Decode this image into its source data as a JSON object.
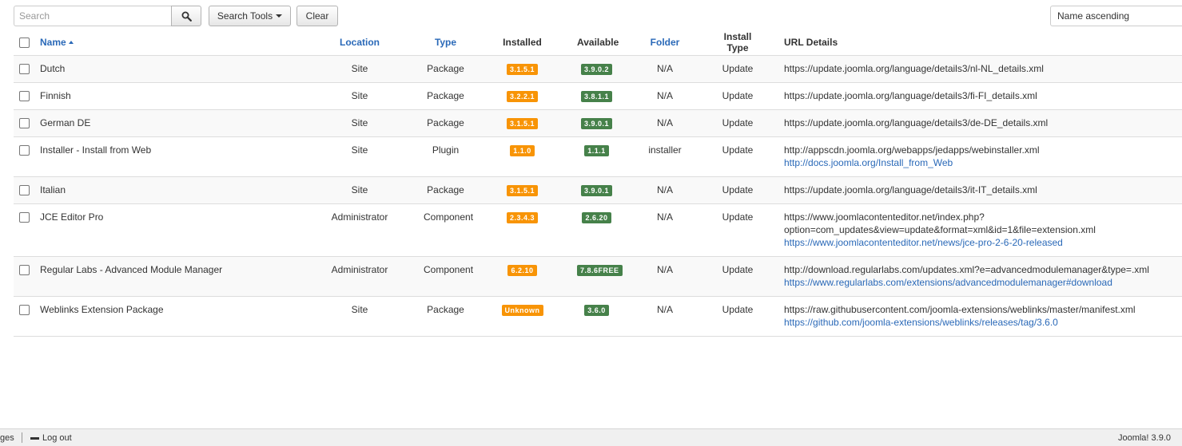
{
  "toolbar": {
    "search_placeholder": "Search",
    "search_icon": "magnifier-icon",
    "search_tools_label": "Search Tools",
    "clear_label": "Clear",
    "sort_value": "Name ascending"
  },
  "table": {
    "columns": {
      "name": "Name",
      "location": "Location",
      "type": "Type",
      "installed": "Installed",
      "available": "Available",
      "folder": "Folder",
      "install_type": "Install Type",
      "url_details": "URL Details"
    },
    "rows": [
      {
        "name": "Dutch",
        "location": "Site",
        "type": "Package",
        "installed": "3.1.5.1",
        "available": "3.9.0.2",
        "folder": "N/A",
        "install_type": "Update",
        "url": "https://update.joomla.org/language/details3/nl-NL_details.xml",
        "url2": "",
        "link": ""
      },
      {
        "name": "Finnish",
        "location": "Site",
        "type": "Package",
        "installed": "3.2.2.1",
        "available": "3.8.1.1",
        "folder": "N/A",
        "install_type": "Update",
        "url": "https://update.joomla.org/language/details3/fi-FI_details.xml",
        "url2": "",
        "link": ""
      },
      {
        "name": "German DE",
        "location": "Site",
        "type": "Package",
        "installed": "3.1.5.1",
        "available": "3.9.0.1",
        "folder": "N/A",
        "install_type": "Update",
        "url": "https://update.joomla.org/language/details3/de-DE_details.xml",
        "url2": "",
        "link": ""
      },
      {
        "name": "Installer - Install from Web",
        "location": "Site",
        "type": "Plugin",
        "installed": "1.1.0",
        "available": "1.1.1",
        "folder": "installer",
        "install_type": "Update",
        "url": "http://appscdn.joomla.org/webapps/jedapps/webinstaller.xml",
        "url2": "",
        "link": "http://docs.joomla.org/Install_from_Web"
      },
      {
        "name": "Italian",
        "location": "Site",
        "type": "Package",
        "installed": "3.1.5.1",
        "available": "3.9.0.1",
        "folder": "N/A",
        "install_type": "Update",
        "url": "https://update.joomla.org/language/details3/it-IT_details.xml",
        "url2": "",
        "link": ""
      },
      {
        "name": "JCE Editor Pro",
        "location": "Administrator",
        "type": "Component",
        "installed": "2.3.4.3",
        "available": "2.6.20",
        "folder": "N/A",
        "install_type": "Update",
        "url": "https://www.joomlacontenteditor.net/index.php?",
        "url2": "option=com_updates&view=update&format=xml&id=1&file=extension.xml",
        "link": "https://www.joomlacontenteditor.net/news/jce-pro-2-6-20-released"
      },
      {
        "name": "Regular Labs - Advanced Module Manager",
        "location": "Administrator",
        "type": "Component",
        "installed": "6.2.10",
        "available": "7.8.6FREE",
        "folder": "N/A",
        "install_type": "Update",
        "url": "http://download.regularlabs.com/updates.xml?e=advancedmodulemanager&type=.xml",
        "url2": "",
        "link": "https://www.regularlabs.com/extensions/advancedmodulemanager#download"
      },
      {
        "name": "Weblinks Extension Package",
        "location": "Site",
        "type": "Package",
        "installed": "Unknown",
        "available": "3.6.0",
        "folder": "N/A",
        "install_type": "Update",
        "url": "https://raw.githubusercontent.com/joomla-extensions/weblinks/master/manifest.xml",
        "url2": "",
        "link": "https://github.com/joomla-extensions/weblinks/releases/tag/3.6.0"
      }
    ]
  },
  "footer": {
    "left_text": "ges",
    "logout_label": "Log out",
    "version": "Joomla! 3.9.0"
  },
  "colors": {
    "installed_badge": "#f89406",
    "available_badge": "#46814a",
    "link": "#2a69b8"
  }
}
